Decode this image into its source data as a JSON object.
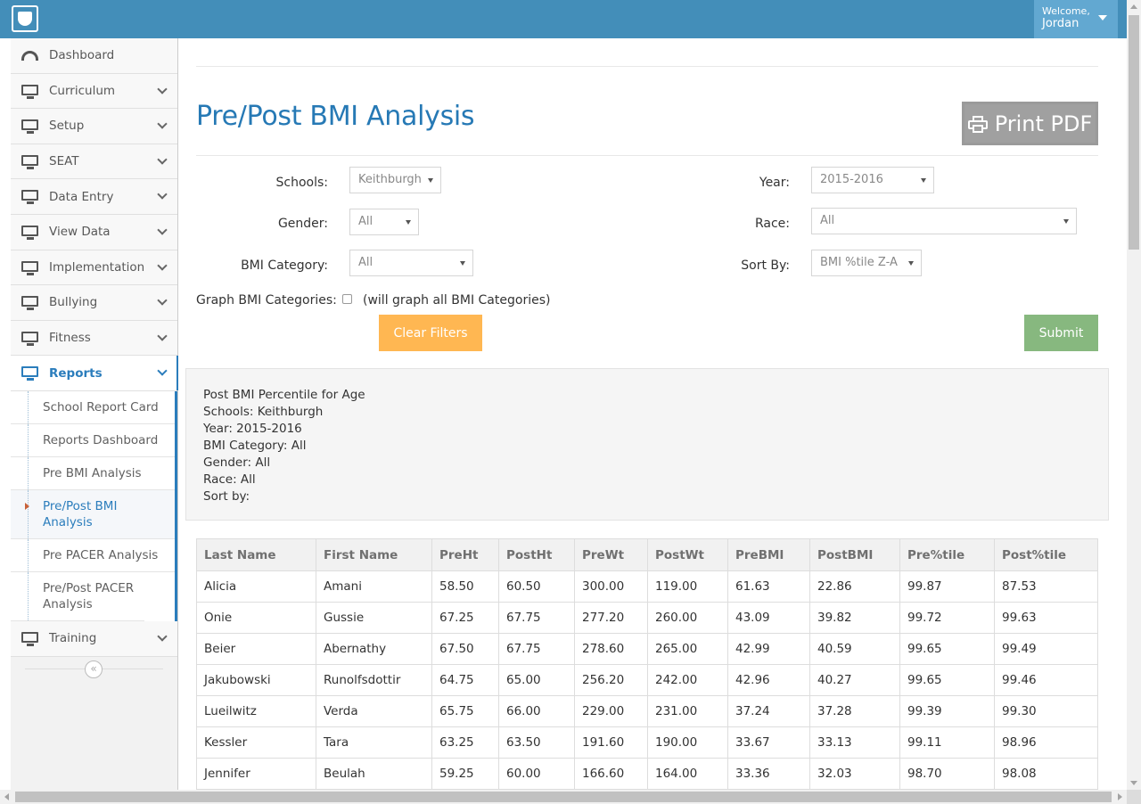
{
  "header": {
    "welcome": "Welcome,",
    "user_name": "Jordan"
  },
  "sidebar": {
    "items": [
      {
        "label": "Dashboard",
        "icon": "dashboard-icon"
      },
      {
        "label": "Curriculum",
        "icon": "monitor-icon"
      },
      {
        "label": "Setup",
        "icon": "monitor-icon"
      },
      {
        "label": "SEAT",
        "icon": "monitor-icon"
      },
      {
        "label": "Data Entry",
        "icon": "monitor-icon"
      },
      {
        "label": "View Data",
        "icon": "monitor-icon"
      },
      {
        "label": "Implementation",
        "icon": "monitor-icon"
      },
      {
        "label": "Bullying",
        "icon": "monitor-icon"
      },
      {
        "label": "Fitness",
        "icon": "monitor-icon"
      },
      {
        "label": "Reports",
        "icon": "monitor-icon"
      },
      {
        "label": "Training",
        "icon": "monitor-icon"
      }
    ],
    "reports_submenu": [
      "School Report Card",
      "Reports Dashboard",
      "Pre BMI Analysis",
      "Pre/Post BMI Analysis",
      "Pre PACER Analysis",
      "Pre/Post PACER Analysis"
    ],
    "collapse_glyph": "«"
  },
  "page": {
    "title": "Pre/Post BMI Analysis",
    "print_label": "Print PDF"
  },
  "filters": {
    "schools_label": "Schools:",
    "schools_value": "Keithburgh",
    "year_label": "Year:",
    "year_value": "2015-2016",
    "gender_label": "Gender:",
    "gender_value": "All",
    "race_label": "Race:",
    "race_value": "All",
    "bmi_label": "BMI Category:",
    "bmi_value": "All",
    "sort_label": "Sort By:",
    "sort_value": "BMI %tile Z-A",
    "graph_label": "Graph BMI Categories:",
    "graph_note": "(will graph all BMI Categories)",
    "clear_label": "Clear Filters",
    "submit_label": "Submit"
  },
  "summary": [
    "Post BMI Percentile for Age",
    "Schools: Keithburgh",
    "Year: 2015-2016",
    "BMI Category: All",
    "Gender: All",
    "Race: All",
    "Sort by:"
  ],
  "table": {
    "headers": [
      "Last Name",
      "First Name",
      "PreHt",
      "PostHt",
      "PreWt",
      "PostWt",
      "PreBMI",
      "PostBMI",
      "Pre%tile",
      "Post%tile"
    ],
    "rows": [
      [
        "Alicia",
        "Amani",
        "58.50",
        "60.50",
        "300.00",
        "119.00",
        "61.63",
        "22.86",
        "99.87",
        "87.53"
      ],
      [
        "Onie",
        "Gussie",
        "67.25",
        "67.75",
        "277.20",
        "260.00",
        "43.09",
        "39.82",
        "99.72",
        "99.63"
      ],
      [
        "Beier",
        "Abernathy",
        "67.50",
        "67.75",
        "278.60",
        "265.00",
        "42.99",
        "40.59",
        "99.65",
        "99.49"
      ],
      [
        "Jakubowski",
        "Runolfsdottir",
        "64.75",
        "65.00",
        "256.20",
        "242.00",
        "42.96",
        "40.27",
        "99.65",
        "99.46"
      ],
      [
        "Lueilwitz",
        "Verda",
        "65.75",
        "66.00",
        "229.00",
        "231.00",
        "37.24",
        "37.28",
        "99.39",
        "99.30"
      ],
      [
        "Kessler",
        "Tara",
        "63.25",
        "63.50",
        "191.60",
        "190.00",
        "33.67",
        "33.13",
        "99.11",
        "98.96"
      ],
      [
        "Jennifer",
        "Beulah",
        "59.25",
        "60.00",
        "166.60",
        "164.00",
        "33.36",
        "32.03",
        "98.70",
        "98.08"
      ]
    ]
  }
}
